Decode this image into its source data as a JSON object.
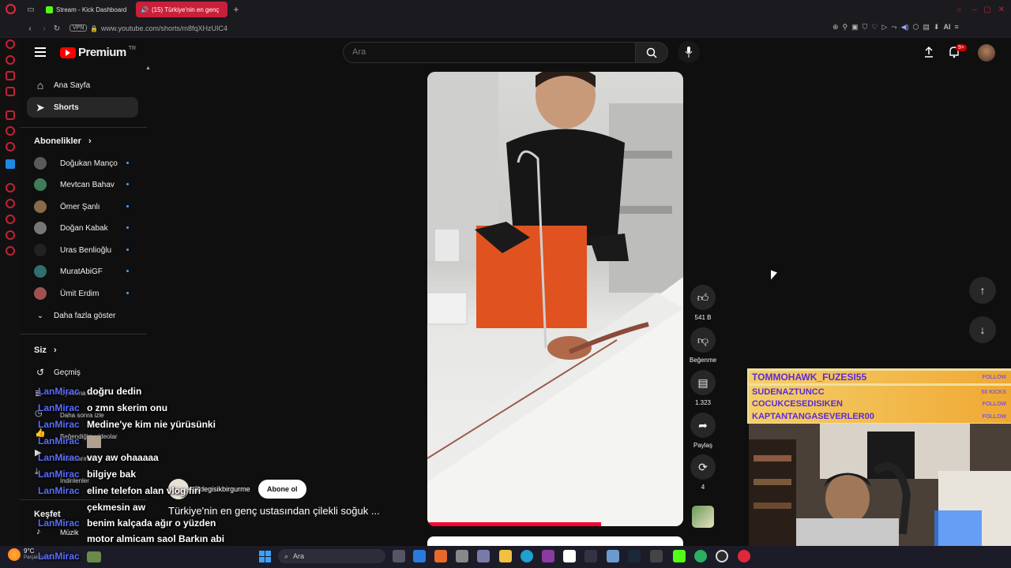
{
  "browser": {
    "tabs": [
      {
        "label": "Stream - Kick Dashboard"
      },
      {
        "label": "(15) Türkiye'nin en genç"
      }
    ],
    "vpn_label": "VPN",
    "url": "www.youtube.com/shorts/m8fqXHzUIC4",
    "ai_label": "AI"
  },
  "yt": {
    "logo_text": "Premium",
    "logo_region": "TR",
    "search_placeholder": "Ara",
    "notif_count": "9+",
    "nav": {
      "home": "Ana Sayfa",
      "shorts": "Shorts"
    },
    "subs_header": "Abonelikler",
    "subs": [
      {
        "name": "Doğukan Manço",
        "color": "#5a5a5a"
      },
      {
        "name": "Mevtcan Bahav",
        "color": "#3f7d58"
      },
      {
        "name": "Ömer Şanlı",
        "color": "#8a6a4a"
      },
      {
        "name": "Doğan Kabak",
        "color": "#777777"
      },
      {
        "name": "Uras Benlioğlu",
        "color": "#222222"
      },
      {
        "name": "MuratAbiGF",
        "color": "#2f6f6f"
      },
      {
        "name": "Ümit Erdim",
        "color": "#a05050"
      }
    ],
    "show_more": "Daha fazla göster",
    "you_header": "Siz",
    "you_items": [
      "Geçmiş",
      "Oynatma listeleri",
      "Daha sonra izle",
      "Beğendiğim videolar",
      "Videolarınız",
      "İndirilenler"
    ],
    "explore_header": "Keşfet",
    "explore_items": [
      "Müzik"
    ],
    "video": {
      "channel": "@degisikbirgurme",
      "subscribe_label": "Abone ol",
      "title": "Türkiye'nin en genç ustasından çilekli soğuk ...",
      "likes": "541 B",
      "dislike_label": "Beğenme",
      "comments": "1.323",
      "share_label": "Paylaş",
      "remix_count": "4"
    }
  },
  "stream": {
    "chat": [
      {
        "user": "LanMirac",
        "msg": "doğru dedin"
      },
      {
        "user": "LanMirac",
        "msg": "o zmn skerim onu"
      },
      {
        "user": "LanMirac",
        "msg": "Medine'ye kim nie yürüsünki"
      },
      {
        "user": "LanMirac",
        "msg": ""
      },
      {
        "user": "LanMirac",
        "msg": "vay aw ohaaaaa"
      },
      {
        "user": "LanMirac",
        "msg": "bilgiye bak"
      },
      {
        "user": "LanMirac",
        "msg": "eline telefon alan vlog firi"
      },
      {
        "user": "",
        "msg": "çekmesin aw"
      },
      {
        "user": "LanMirac",
        "msg": "benim kalçada ağır o yüzden"
      },
      {
        "user": "",
        "msg": "motor almicam saol Barkın abi"
      },
      {
        "user": "LanMirac",
        "msg": ""
      }
    ],
    "follows": [
      {
        "name": "TOMMOHAWK_FUZESI55",
        "tag": "FOLLOW"
      },
      {
        "name": "SUDENAZTUNCC",
        "tag": "50 KICKS"
      },
      {
        "name": "COCUKCESEDISIKEN",
        "tag": "FOLLOW"
      },
      {
        "name": "KAPTANTANGASEVERLER00",
        "tag": "FOLLOW"
      }
    ]
  },
  "taskbar": {
    "weather_temp": "9°C",
    "weather_desc": "Parçalı bulutlu",
    "search_placeholder": "Ara"
  }
}
